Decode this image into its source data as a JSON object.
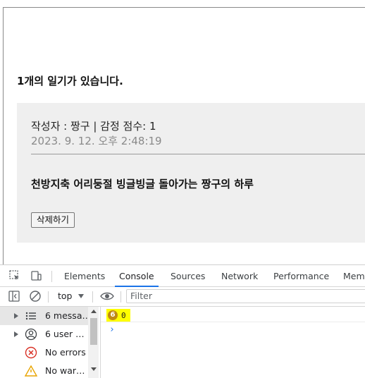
{
  "page": {
    "heading": "1개의 일기가 있습니다.",
    "diary": {
      "author_line": "작성자 : 짱구 | 감정 점수: 1",
      "date": "2023. 9. 12. 오후 2:48:19",
      "content": "천방지축 어리둥절 빙글빙글 돌아가는 짱구의 하루",
      "delete_label": "삭제하기"
    }
  },
  "devtools": {
    "tabs": [
      "Elements",
      "Console",
      "Sources",
      "Network",
      "Performance",
      "Mem"
    ],
    "active_tab": "Console",
    "toolbar": {
      "context": "top",
      "filter_placeholder": "Filter"
    },
    "sidebar": {
      "items": [
        {
          "label": "6 messa…",
          "icon": "list-icon"
        },
        {
          "label": "6 user …",
          "icon": "user-icon"
        },
        {
          "label": "No errors",
          "icon": "error-icon"
        },
        {
          "label": "No war…",
          "icon": "warning-icon"
        }
      ]
    },
    "console": {
      "repeat_count": "6",
      "log_value": "0",
      "prompt": "›"
    },
    "colors": {
      "accent": "#1a73e8",
      "highlight": "#ffff00",
      "error": "#d93025",
      "warning": "#e8a400"
    }
  }
}
